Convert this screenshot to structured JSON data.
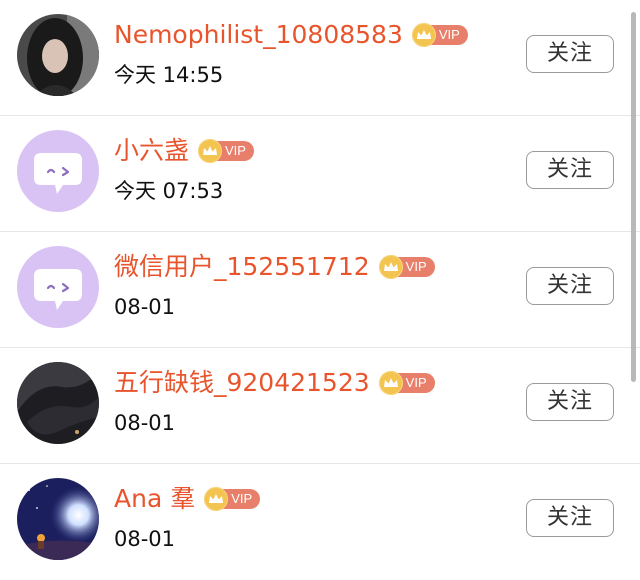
{
  "follow_list": {
    "follow_label": "关注",
    "vip_label": "VIP",
    "items": [
      {
        "name": "Nemophilist_10808583",
        "time": "今天 14:55",
        "avatar": "photo-portrait"
      },
      {
        "name": "小六盏",
        "time": "今天 07:53",
        "avatar": "default-chat-bubble"
      },
      {
        "name": "微信用户_152551712",
        "time": "08-01",
        "avatar": "default-chat-bubble"
      },
      {
        "name": "五行缺钱_920421523",
        "time": "08-01",
        "avatar": "photo-night-sky"
      },
      {
        "name": "Ana 羣",
        "time": "08-01",
        "avatar": "photo-starry-landscape"
      }
    ]
  },
  "colors": {
    "name": "#e8552d",
    "vip_badge": "#e77f6b",
    "vip_crown": "#f4c451",
    "default_avatar_bg": "#d9c3f5"
  }
}
